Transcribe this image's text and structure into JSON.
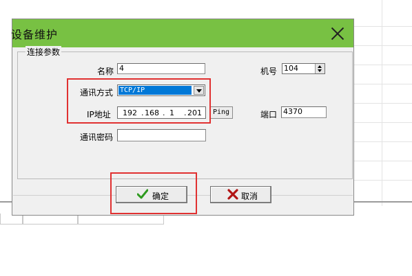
{
  "dialog": {
    "title": "设备维护",
    "group_title": "连接参数",
    "fields": {
      "name_label": "名称",
      "name_value": "4",
      "machine_no_label": "机号",
      "machine_no_value": "104",
      "comm_mode_label": "通讯方式",
      "comm_mode_value": "TCP/IP",
      "ip_label": "IP地址",
      "ip_octets": [
        "192",
        "168",
        "1",
        "201"
      ],
      "ip_dots": ".",
      "ping_label": "Ping",
      "port_label": "端口",
      "port_value": "4370",
      "password_label": "通讯密码",
      "password_value": ""
    },
    "buttons": {
      "ok_label": "确定",
      "cancel_label": "取消"
    }
  },
  "colors": {
    "titlebar": "#78c143",
    "selection": "#0078d7",
    "highlight": "#e03030",
    "ok_icon": "#2e9a1f",
    "cancel_icon": "#b21515"
  },
  "icons": {
    "close": "close-icon",
    "ok": "checkmark-icon",
    "cancel": "x-icon",
    "dropdown": "chevron-down-icon",
    "spin": "spinner-arrows-icon"
  }
}
